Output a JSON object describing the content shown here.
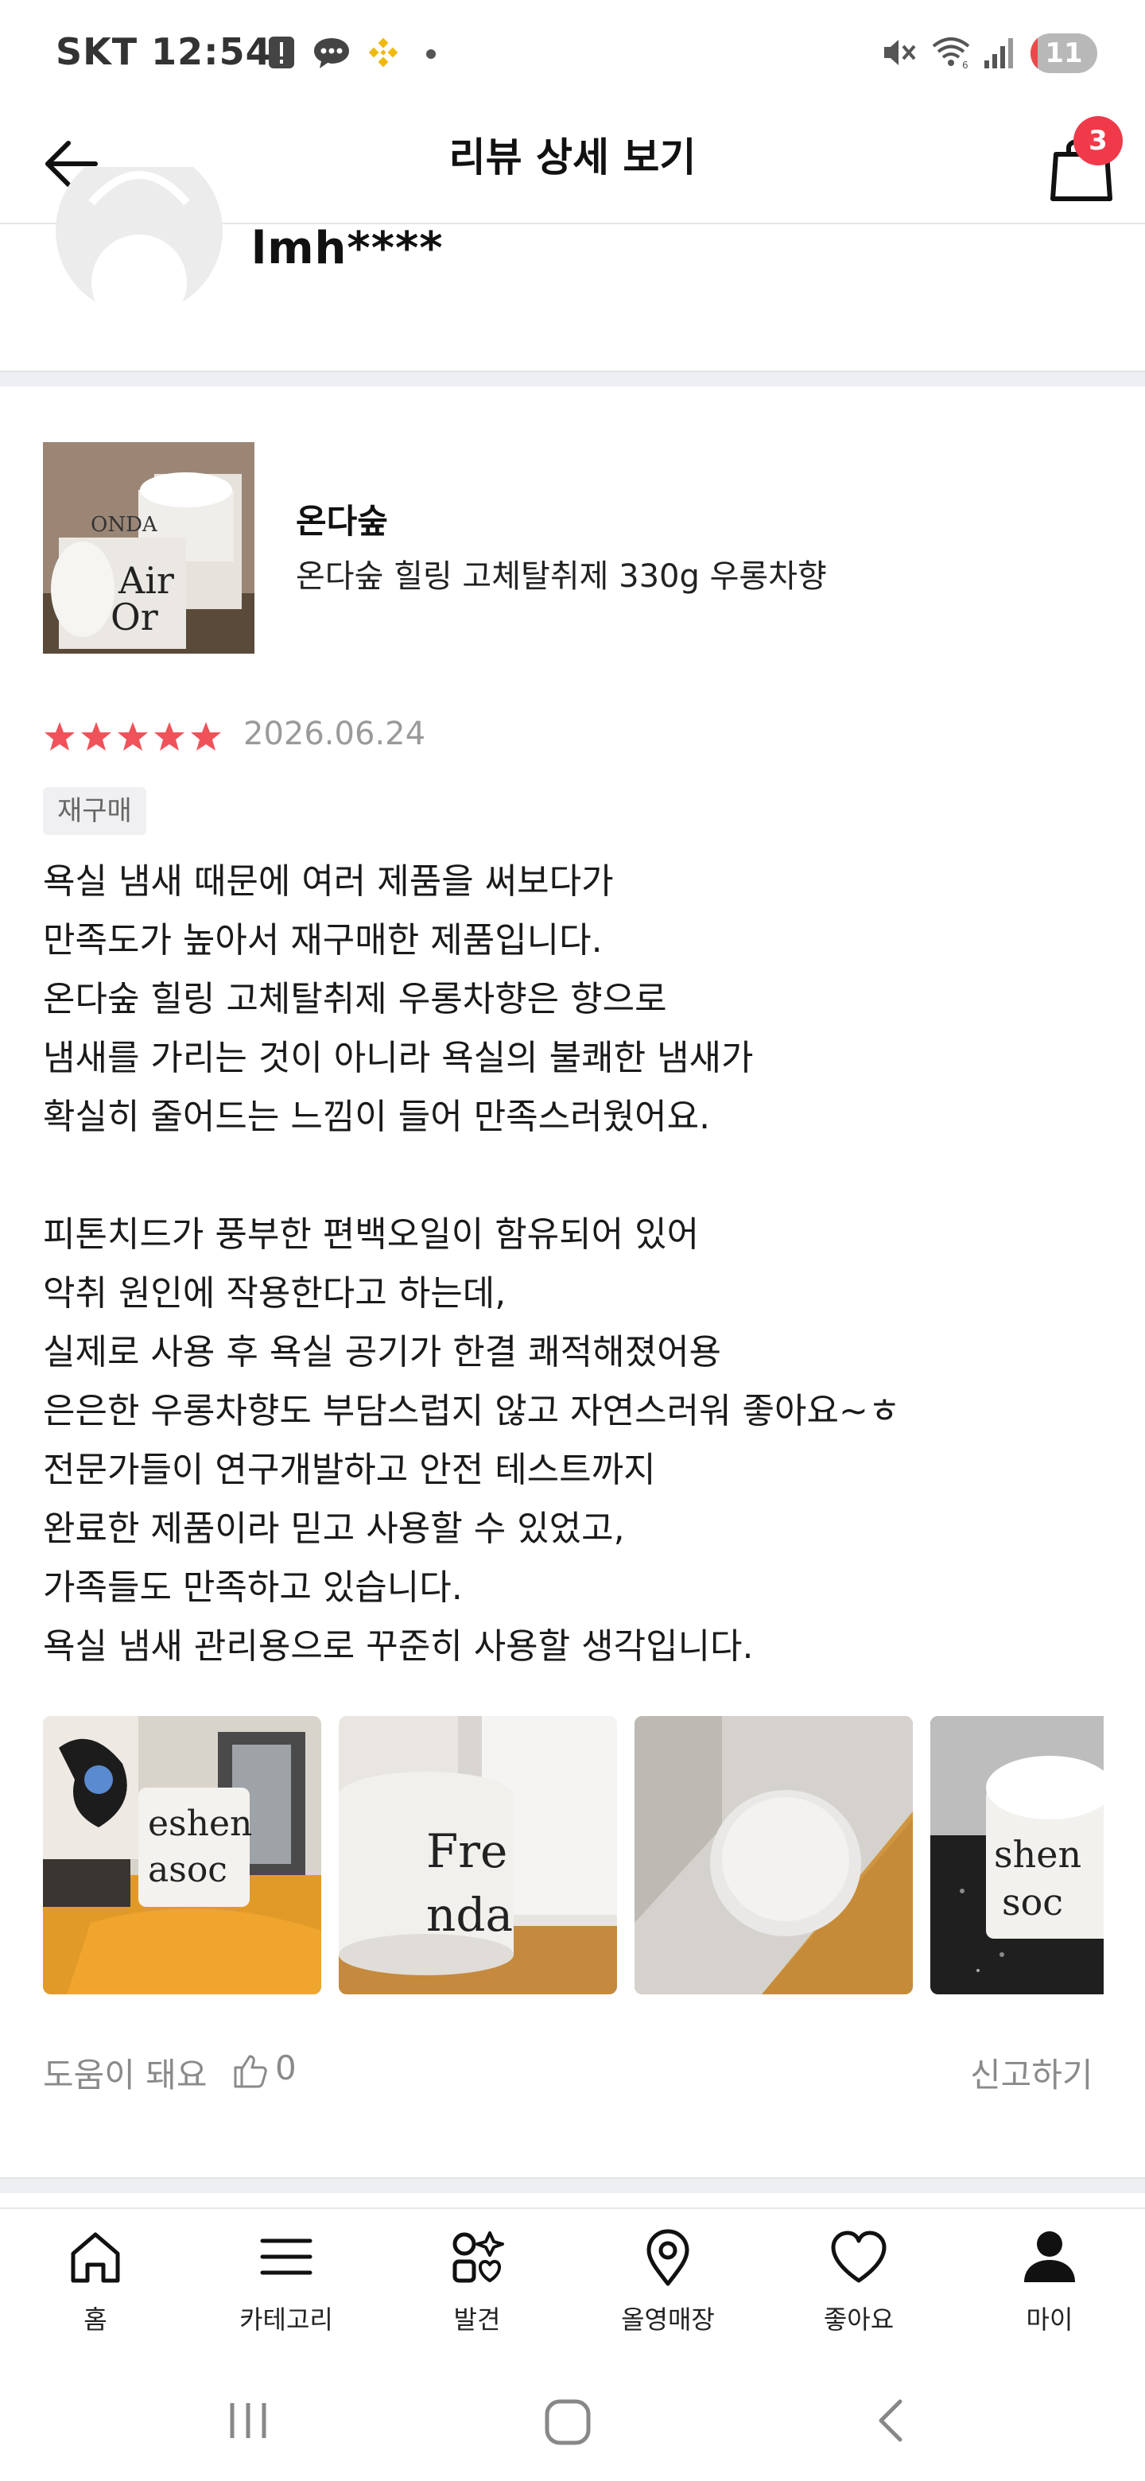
{
  "status_bar": {
    "carrier": "SKT",
    "time": "12:54",
    "battery": "11",
    "battery_level": 0.11
  },
  "header": {
    "title": "리뷰 상세 보기",
    "cart_count": "3"
  },
  "reviewer": {
    "username": "lmh****"
  },
  "product": {
    "brand": "온다숲",
    "name": "온다숲 힐링 고체탈취제 330g 우롱차향"
  },
  "review": {
    "rating": 5,
    "date": "2026.06.24",
    "tag": "재구매",
    "text": "욕실 냄새 때문에 여러 제품을 써보다가\n만족도가 높아서 재구매한 제품입니다.\n온다숲 힐링 고체탈취제 우롱차향은 향으로\n냄새를 가리는 것이 아니라 욕실의 불쾌한 냄새가\n확실히 줄어드는 느낌이 들어 만족스러웠어요.\n\n피톤치드가 풍부한 편백오일이 함유되어 있어\n악취 원인에 작용한다고 하는데,\n실제로 사용 후 욕실 공기가 한결 쾌적해졌어용\n은은한 우롱차향도 부담스럽지 않고 자연스러워 좋아요~ㅎ\n전문가들이 연구개발하고 안전 테스트까지\n완료한 제품이라 믿고 사용할 수 있었고,\n가족들도 만족하고 있습니다.\n욕실 냄새 관리용으로 꾸준히 사용할 생각입니다."
  },
  "actions": {
    "helpful_label": "도움이 돼요",
    "helpful_count": "0",
    "report_label": "신고하기"
  },
  "bottom_nav": {
    "items": [
      {
        "label": "홈",
        "icon": "home-icon"
      },
      {
        "label": "카테고리",
        "icon": "menu-icon"
      },
      {
        "label": "발견",
        "icon": "discover-icon"
      },
      {
        "label": "올영매장",
        "icon": "location-icon"
      },
      {
        "label": "좋아요",
        "icon": "heart-icon"
      },
      {
        "label": "마이",
        "icon": "person-icon"
      }
    ]
  },
  "colors": {
    "star": "#f0525a",
    "badge": "#f03a4a",
    "muted_text": "#8a8a8a"
  }
}
